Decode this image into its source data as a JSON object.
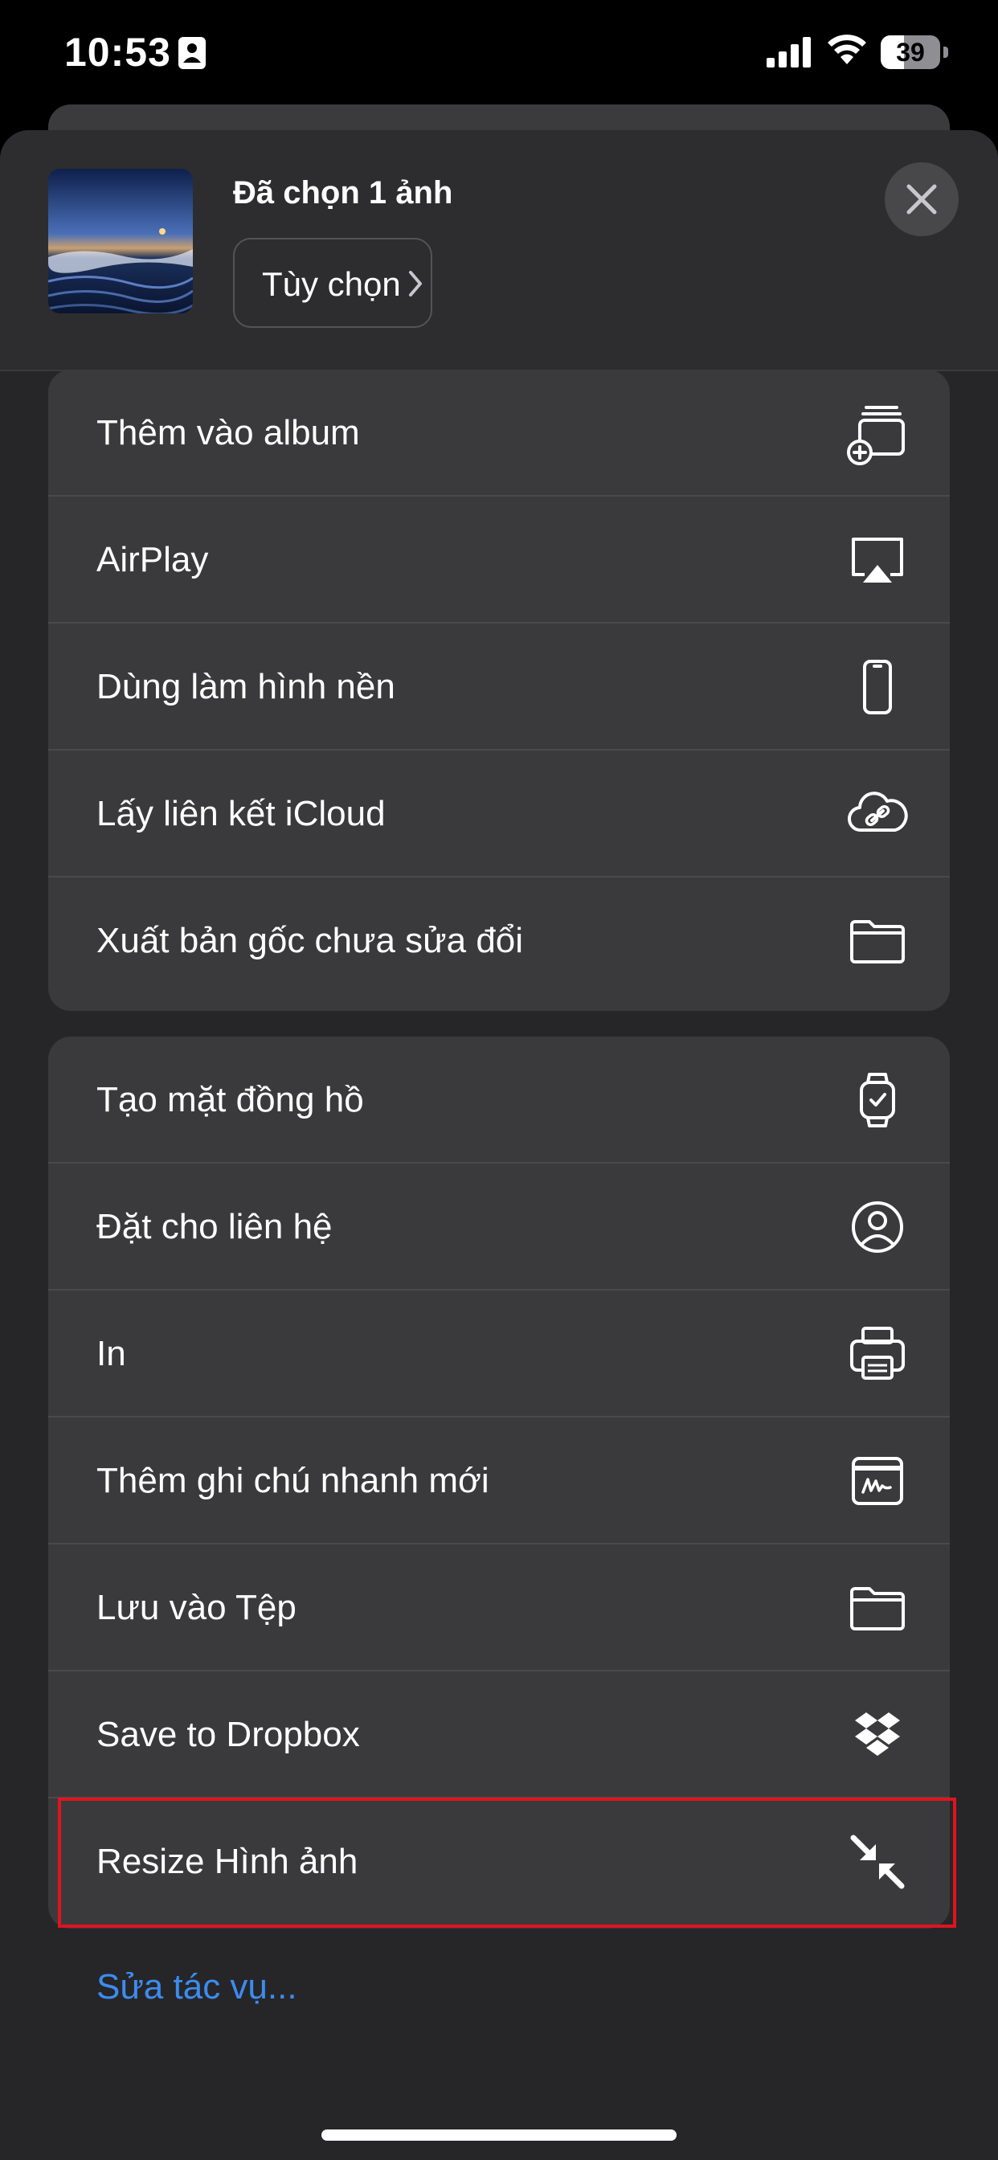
{
  "status_bar": {
    "time": "10:53",
    "battery": "39",
    "battery_level": 0.39
  },
  "header": {
    "title": "Đã chọn 1 ảnh",
    "options_label": "Tùy chọn"
  },
  "group1": [
    {
      "label": "Thêm vào album",
      "icon": "add-to-album-icon"
    },
    {
      "label": "AirPlay",
      "icon": "airplay-icon"
    },
    {
      "label": "Dùng làm hình nền",
      "icon": "iphone-icon"
    },
    {
      "label": "Lấy liên kết iCloud",
      "icon": "cloud-link-icon"
    },
    {
      "label": "Xuất bản gốc chưa sửa đổi",
      "icon": "folder-icon"
    }
  ],
  "group2": [
    {
      "label": "Tạo mặt đồng hồ",
      "icon": "watch-icon"
    },
    {
      "label": "Đặt cho liên hệ",
      "icon": "person-circle-icon"
    },
    {
      "label": "In",
      "icon": "printer-icon"
    },
    {
      "label": "Thêm ghi chú nhanh mới",
      "icon": "quick-note-icon"
    },
    {
      "label": "Lưu vào Tệp",
      "icon": "folder-icon"
    },
    {
      "label": "Save to Dropbox",
      "icon": "dropbox-icon"
    },
    {
      "label": "Resize Hình ảnh",
      "icon": "resize-arrows-icon"
    }
  ],
  "edit_actions_label": "Sửa tác vụ...",
  "colors": {
    "accent": "#3c8cf0",
    "highlight": "#e0141e",
    "sheet": "#262628",
    "row": "#3a3a3c"
  }
}
